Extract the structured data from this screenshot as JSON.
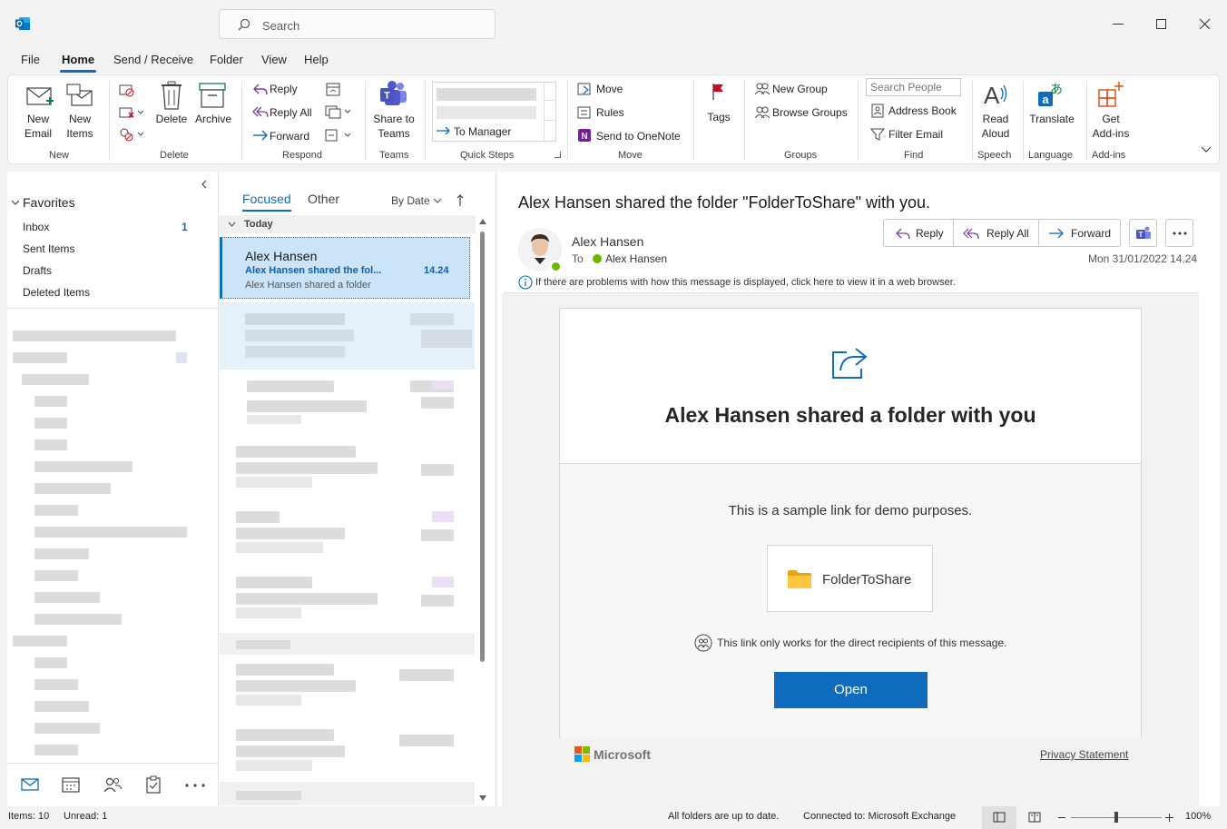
{
  "app": {
    "search_placeholder": "Search"
  },
  "menu": {
    "items": [
      "File",
      "Home",
      "Send / Receive",
      "Folder",
      "View",
      "Help"
    ],
    "active": "Home"
  },
  "ribbon": {
    "new_email": "New\nEmail",
    "new_items": "New\nItems",
    "delete": "Delete",
    "archive": "Archive",
    "reply": "Reply",
    "reply_all": "Reply All",
    "forward": "Forward",
    "share_to_teams": "Share to\nTeams",
    "quick_step_to_manager": "To Manager",
    "move": "Move",
    "rules": "Rules",
    "send_to_onenote": "Send to OneNote",
    "tags": "Tags",
    "new_group": "New Group",
    "browse_groups": "Browse Groups",
    "search_people_placeholder": "Search People",
    "address_book": "Address Book",
    "filter_email": "Filter Email",
    "read_aloud": "Read\nAloud",
    "translate": "Translate",
    "get_add_ins": "Get\nAdd-ins",
    "groups": {
      "new": "New",
      "delete": "Delete",
      "respond": "Respond",
      "teams": "Teams",
      "quick_steps": "Quick Steps",
      "move": "Move",
      "tags_groups": "Groups",
      "find": "Find",
      "speech": "Speech",
      "language": "Language",
      "add_ins": "Add-ins"
    }
  },
  "folders": {
    "favorites_label": "Favorites",
    "items": [
      {
        "name": "Inbox",
        "count": "1"
      },
      {
        "name": "Sent Items",
        "count": ""
      },
      {
        "name": "Drafts",
        "count": ""
      },
      {
        "name": "Deleted Items",
        "count": ""
      }
    ]
  },
  "message_list": {
    "tab_focused": "Focused",
    "tab_other": "Other",
    "sort": "By Date",
    "group_today": "Today",
    "selected": {
      "sender": "Alex Hansen",
      "subject": "Alex Hansen shared the fol...",
      "time": "14.24",
      "preview": "Alex Hansen shared a folder"
    }
  },
  "reading": {
    "subject": "Alex Hansen shared the folder \"FolderToShare\" with you.",
    "sender": "Alex Hansen",
    "to_label": "To",
    "to_name": "Alex Hansen",
    "date": "Mon 31/01/2022 14.24",
    "reply": "Reply",
    "reply_all": "Reply All",
    "forward": "Forward",
    "info_bar": "If there are problems with how this message is displayed, click here to view it in a web browser.",
    "card_heading": "Alex Hansen shared a folder with you",
    "card_text": "This is a sample link for demo purposes.",
    "folder_name": "FolderToShare",
    "link_note": "This link only works for the direct recipients of this message.",
    "open_button": "Open",
    "brand": "Microsoft",
    "privacy": "Privacy Statement"
  },
  "status": {
    "items": "Items: 10",
    "unread": "Unread: 1",
    "sync": "All folders are up to date.",
    "connection": "Connected to: Microsoft Exchange",
    "zoom": "100%"
  },
  "colors": {
    "accent": "#0f6cbd",
    "selected_bg": "#cce4f7",
    "open_button": "#0f6cbd"
  }
}
